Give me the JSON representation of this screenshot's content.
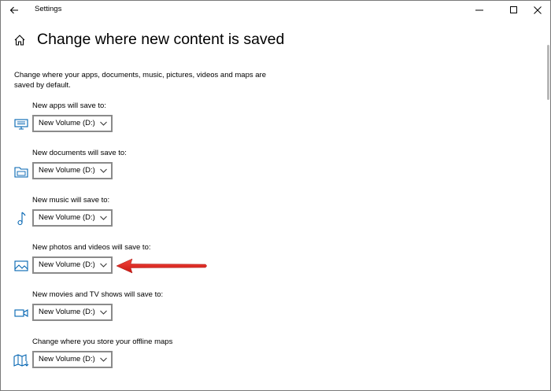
{
  "window": {
    "title": "Settings"
  },
  "header": {
    "title": "Change where new content is saved"
  },
  "description": "Change where your apps, documents, music, pictures, videos and maps are saved by default.",
  "settings": [
    {
      "label": "New apps will save to:",
      "value": "New Volume (D:)",
      "icon": "monitor-icon"
    },
    {
      "label": "New documents will save to:",
      "value": "New Volume (D:)",
      "icon": "folder-icon"
    },
    {
      "label": "New music will save to:",
      "value": "New Volume (D:)",
      "icon": "music-note-icon"
    },
    {
      "label": "New photos and videos will save to:",
      "value": "New Volume (D:)",
      "icon": "photo-icon"
    },
    {
      "label": "New movies and TV shows will save to:",
      "value": "New Volume (D:)",
      "icon": "video-camera-icon"
    },
    {
      "label": "Change where you store your offline maps",
      "value": "New Volume (D:)",
      "icon": "map-icon"
    }
  ],
  "colors": {
    "accent": "#0063b1",
    "annotation_arrow": "#e8231f",
    "dropdown_border": "#8a8a8a"
  }
}
